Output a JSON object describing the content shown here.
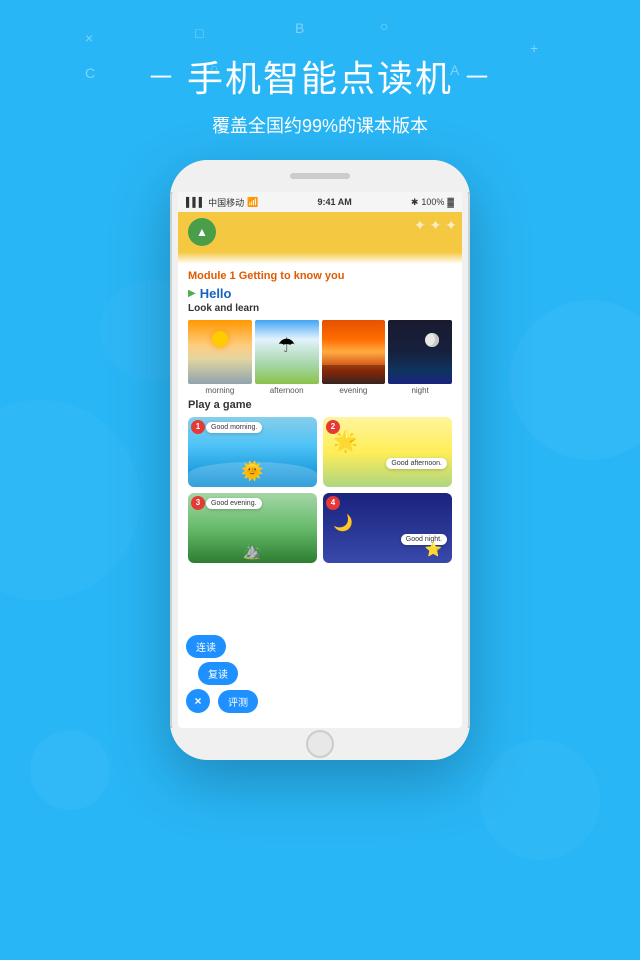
{
  "background": {
    "color": "#29b6f6"
  },
  "header": {
    "title": "手机智能点读机",
    "dash": "－",
    "subtitle": "覆盖全国约99%的课本版本"
  },
  "phone": {
    "status_bar": {
      "carrier": "中国移动",
      "wifi": "WiFi",
      "time": "9:41 AM",
      "bluetooth": "★",
      "battery": "100%"
    },
    "app_header": {
      "logo_text": "▲"
    },
    "content": {
      "module_title": "Module 1  Getting to know you",
      "section": "Hello",
      "look_learn": "Look and learn",
      "images": [
        {
          "label": "morning",
          "type": "morning"
        },
        {
          "label": "afternoon",
          "type": "afternoon"
        },
        {
          "label": "evening",
          "type": "evening"
        },
        {
          "label": "night",
          "type": "night"
        }
      ],
      "play_game_title": "Play a game",
      "game_items": [
        {
          "number": "1",
          "text": "Good morning."
        },
        {
          "number": "2",
          "text": "Good afternoon."
        },
        {
          "number": "3",
          "text": "Good evening."
        },
        {
          "number": "4",
          "text": "Good night."
        }
      ]
    }
  },
  "overlay_buttons": {
    "lian": "连读",
    "fu": "复读",
    "x": "×",
    "ping": "评测"
  },
  "decorative": {
    "shapes": [
      "×",
      "□",
      "B",
      "○",
      "C",
      "○",
      "A",
      "+"
    ]
  }
}
